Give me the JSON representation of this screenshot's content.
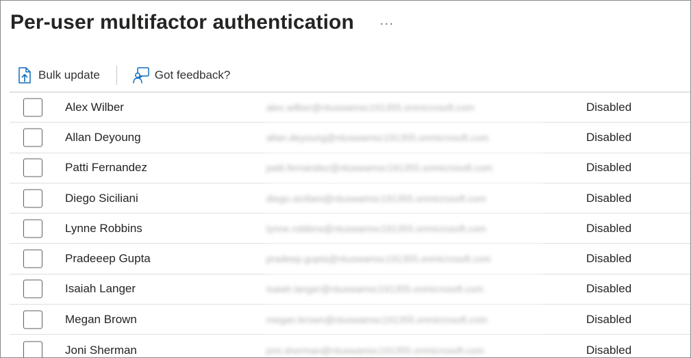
{
  "page": {
    "title": "Per-user multifactor authentication",
    "more_label": "···"
  },
  "toolbar": {
    "bulk_update": {
      "label": "Bulk update",
      "icon": "bulk-update-document-arrow-icon"
    },
    "feedback": {
      "label": "Got feedback?",
      "icon": "feedback-person-icon"
    }
  },
  "users": [
    {
      "name": "Alex Wilber",
      "email": "alex.wilber@ntuswamsc191355.onmicrosoft.com",
      "status": "Disabled"
    },
    {
      "name": "Allan Deyoung",
      "email": "allan.deyoung@ntuswamsc191355.onmicrosoft.com",
      "status": "Disabled"
    },
    {
      "name": "Patti Fernandez",
      "email": "patti.fernandez@ntuswamsc191355.onmicrosoft.com",
      "status": "Disabled"
    },
    {
      "name": "Diego Siciliani",
      "email": "diego.siciliani@ntuswamsc191355.onmicrosoft.com",
      "status": "Disabled"
    },
    {
      "name": "Lynne Robbins",
      "email": "lynne.robbins@ntuswamsc191355.onmicrosoft.com",
      "status": "Disabled"
    },
    {
      "name": "Pradeeep Gupta",
      "email": "pradeep.gupta@ntuswamsc191355.onmicrosoft.com",
      "status": "Disabled"
    },
    {
      "name": "Isaiah Langer",
      "email": "isaiah.langer@ntuswamsc191355.onmicrosoft.com",
      "status": "Disabled"
    },
    {
      "name": "Megan Brown",
      "email": "megan.brown@ntuswamsc191355.onmicrosoft.com",
      "status": "Disabled"
    },
    {
      "name": "Joni Sherman",
      "email": "joni.sherman@ntuswamsc191355.onmicrosoft.com",
      "status": "Disabled"
    }
  ],
  "colors": {
    "accent": "#0f6cbd",
    "text": "#252423",
    "border": "#c8c6c4"
  }
}
